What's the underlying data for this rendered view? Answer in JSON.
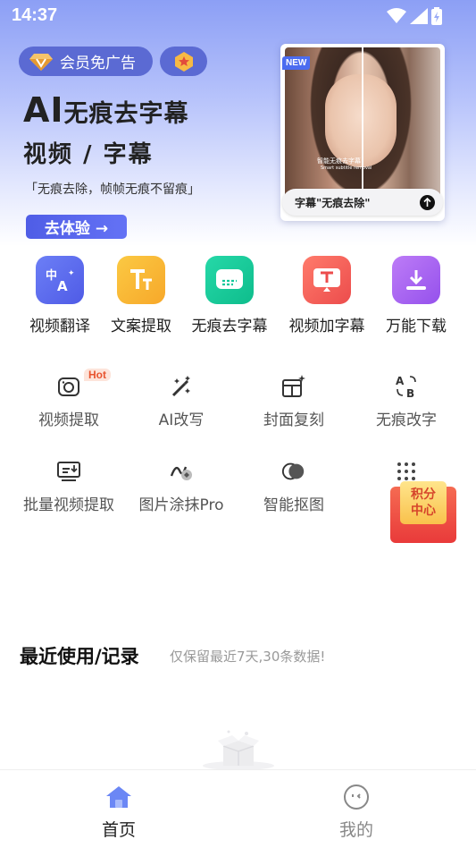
{
  "status_bar": {
    "time": "14:37"
  },
  "hero": {
    "vip_label": "会员免广告",
    "title_ai": "AI",
    "title_rest": "无痕去字幕",
    "subtitle": "视频 / 字幕",
    "description": "「无痕去除，帧帧无痕不留痕」",
    "try_button": "去体验 →",
    "new_badge": "NEW",
    "caption_text": "字幕\"无痕去除\"",
    "preview_sub_1": "智能无痕去字幕",
    "preview_sub_2": "Smart subtitle removal"
  },
  "main_tools": [
    {
      "label": "视频翻译",
      "icon": "translate-icon",
      "color": "#5b6cf0"
    },
    {
      "label": "文案提取",
      "icon": "text-extract-icon",
      "color": "#f9b42a"
    },
    {
      "label": "无痕去字幕",
      "icon": "subtitle-remove-icon",
      "color": "#12c79a"
    },
    {
      "label": "视频加字幕",
      "icon": "add-subtitle-icon",
      "color": "#f0594f"
    },
    {
      "label": "万能下载",
      "icon": "download-icon",
      "color": "#a75cf0"
    }
  ],
  "grid_tools": [
    {
      "label": "视频提取",
      "icon": "video-extract-icon",
      "badge": "Hot"
    },
    {
      "label": "AI改写",
      "icon": "magic-wand-icon"
    },
    {
      "label": "封面复刻",
      "icon": "cover-copy-icon"
    },
    {
      "label": "无痕改字",
      "icon": "text-replace-icon"
    },
    {
      "label": "批量视频提取",
      "icon": "batch-extract-icon"
    },
    {
      "label": "图片涂抹Pro",
      "icon": "image-erase-icon"
    },
    {
      "label": "智能抠图",
      "icon": "cutout-icon"
    },
    {
      "label": "更多",
      "icon": "more-grid-icon"
    }
  ],
  "points_center": {
    "line1": "积分",
    "line2": "中心"
  },
  "recent": {
    "title": "最近使用/记录",
    "note": "仅保留最近7天,30条数据!"
  },
  "bottom_nav": [
    {
      "label": "首页",
      "icon": "home-icon",
      "active": true,
      "color": "#4f6bf0"
    },
    {
      "label": "我的",
      "icon": "profile-icon",
      "active": false,
      "color": "#999999"
    }
  ]
}
